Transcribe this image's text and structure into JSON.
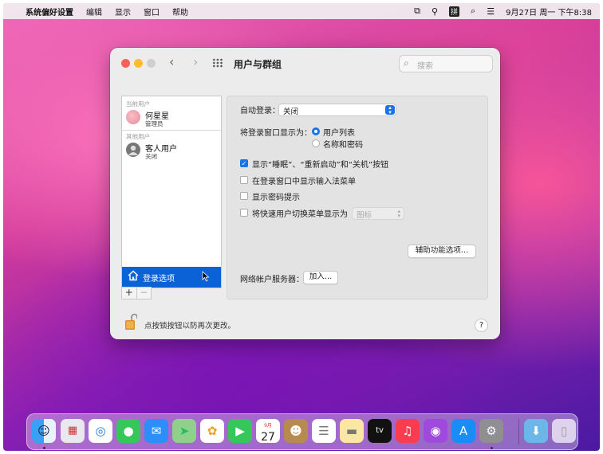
{
  "menubar": {
    "app_name": "系统偏好设置",
    "menus": [
      "编辑",
      "显示",
      "窗口",
      "帮助"
    ],
    "ime_label": "拼",
    "clock": "9月27日 周一 下午8:38"
  },
  "window": {
    "title": "用户与群组",
    "search_placeholder": "搜索"
  },
  "userlist": {
    "current_users_label": "当前用户",
    "current_user": {
      "name": "何星星",
      "role": "管理员"
    },
    "other_users_label": "其他用户",
    "guest_user": {
      "name": "客人用户",
      "status": "关闭"
    },
    "login_options_label": "登录选项",
    "add_label": "+",
    "remove_label": "−"
  },
  "pane": {
    "auto_login_label": "自动登录：",
    "auto_login_value": "关闭",
    "display_login_as_label": "将登录窗口显示为：",
    "radio_user_list": "用户列表",
    "radio_name_password": "名称和密码",
    "cb_show_buttons": "显示“睡眠”、“重新启动”和“关机”按钮",
    "cb_show_input_menu": "在登录窗口中显示输入法菜单",
    "cb_show_password_hints": "显示密码提示",
    "cb_fast_user_switch": "将快速用户切换菜单显示为",
    "fast_user_switch_value": "图标",
    "accessibility_button": "辅助功能选项…",
    "network_server_label": "网络帐户服务器：",
    "join_button": "加入…"
  },
  "footer": {
    "lock_text": "点按锁按钮以防再次更改。",
    "help_label": "?"
  },
  "dock": {
    "calendar_month": "9月",
    "calendar_day": "27",
    "tv_label": "tv"
  }
}
